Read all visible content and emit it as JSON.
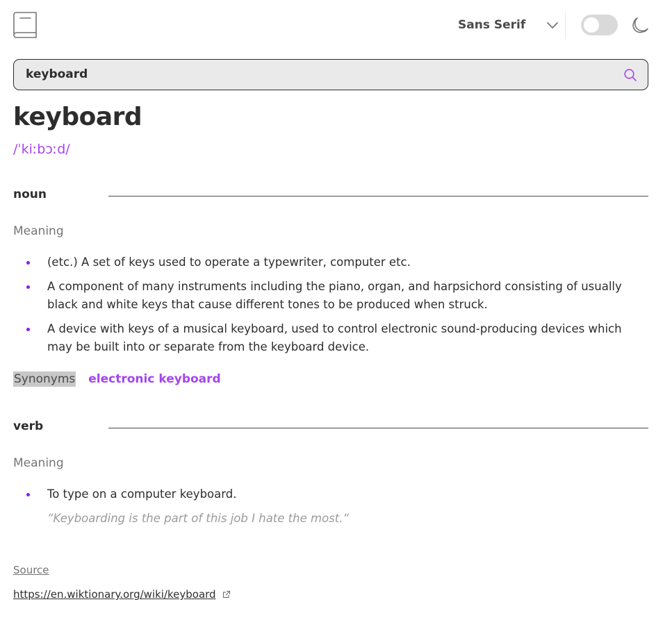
{
  "header": {
    "logo_icon": "book-icon",
    "font_label": "Sans Serif",
    "chevron_icon": "chevron-down-icon",
    "theme_toggle_on": false,
    "moon_icon": "moon-icon"
  },
  "search": {
    "value": "keyboard",
    "icon": "search-icon",
    "accent": "#a445ed"
  },
  "entry": {
    "word": "keyboard",
    "phonetic": "/ˈkiːbɔːd/",
    "noun": {
      "label": "noun",
      "meaning_label": "Meaning",
      "definitions": [
        "(etc.) A set of keys used to operate a typewriter, computer etc.",
        "A component of many instruments including the piano, organ, and harpsichord consisting of usually black and white keys that cause different tones to be produced when struck.",
        "A device with keys of a musical keyboard, used to control electronic sound-producing devices which may be built into or separate from the keyboard device."
      ],
      "synonyms_label": "Synonyms",
      "synonym": "electronic keyboard"
    },
    "verb": {
      "label": "verb",
      "meaning_label": "Meaning",
      "definition": "To type on a computer keyboard.",
      "example": "“Keyboarding is the part of this job I hate the most.“"
    }
  },
  "footer": {
    "source_label": "Source",
    "source_url": "https://en.wiktionary.org/wiki/keyboard",
    "external_icon": "external-link-icon"
  },
  "colors": {
    "accent": "#a445ed",
    "bullet": "#8f19e8",
    "text": "#2d2d2d",
    "muted": "#757575"
  }
}
